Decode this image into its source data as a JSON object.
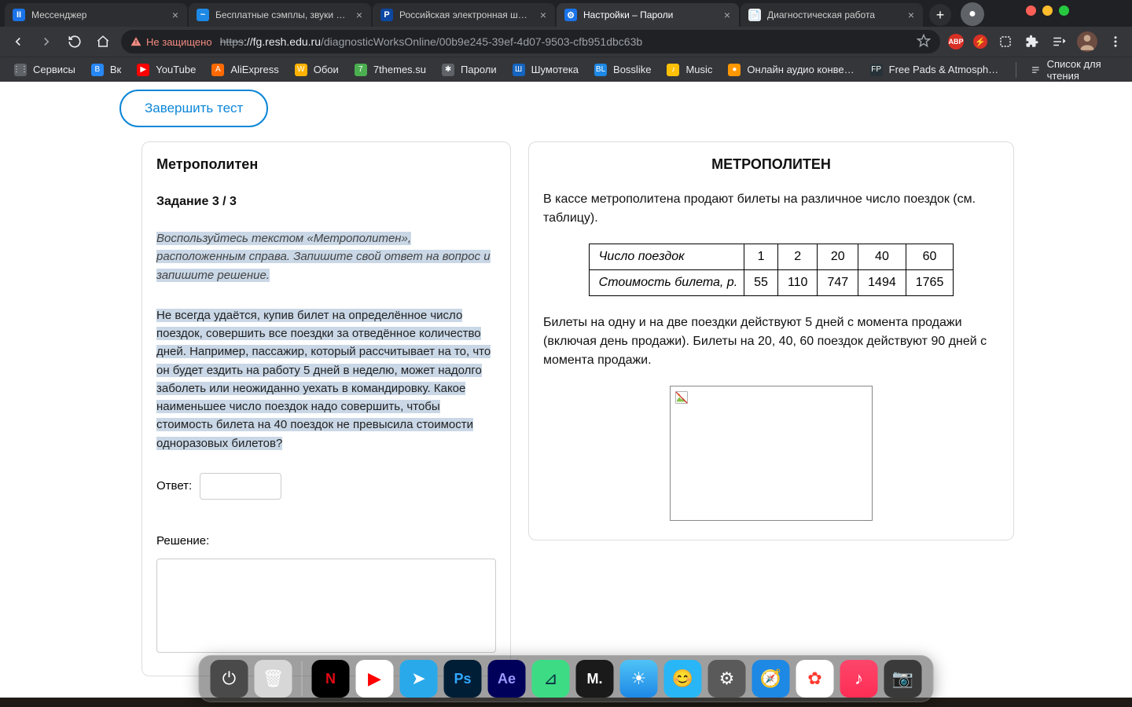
{
  "traffic_lights": [
    "red",
    "yellow",
    "green"
  ],
  "tabs": [
    {
      "favicon_bg": "#1a73e8",
      "favicon_txt": "II",
      "title": "Мессенджер",
      "active": false
    },
    {
      "favicon_bg": "#1e88e5",
      "favicon_txt": "~",
      "title": "Бесплатные сэмплы, звуки и лупы",
      "active": false
    },
    {
      "favicon_bg": "#0d47a1",
      "favicon_txt": "Р",
      "title": "Российская электронная школа",
      "active": false
    },
    {
      "favicon_bg": "#1a73e8",
      "favicon_txt": "⚙",
      "title": "Настройки – Пароли",
      "active": true
    },
    {
      "favicon_bg": "#eceff1",
      "favicon_txt": "📄",
      "title": "Диагностическая работа",
      "active": false
    }
  ],
  "toolbar": {
    "not_secure": "Не защищено",
    "url_strike": "https",
    "url_host": "://fg.resh.edu.ru",
    "url_path": "/diagnosticWorksOnline/00b9e245-39ef-4d07-9503-cfb951dbc63b"
  },
  "ext": {
    "abp": "ABP"
  },
  "bookmarks": [
    {
      "icon_bg": "#5f6368",
      "icon_txt": "⋮⋮",
      "label": "Сервисы"
    },
    {
      "icon_bg": "#2787f5",
      "icon_txt": "В",
      "label": "Вк"
    },
    {
      "icon_bg": "#ff0000",
      "icon_txt": "▶",
      "label": "YouTube"
    },
    {
      "icon_bg": "#ff6a00",
      "icon_txt": "A",
      "label": "AliExpress"
    },
    {
      "icon_bg": "#ffb300",
      "icon_txt": "W",
      "label": "Обои"
    },
    {
      "icon_bg": "#4caf50",
      "icon_txt": "7",
      "label": "7themes.su"
    },
    {
      "icon_bg": "#5f6368",
      "icon_txt": "✱",
      "label": "Пароли"
    },
    {
      "icon_bg": "#1565c0",
      "icon_txt": "Ш",
      "label": "Шумотека"
    },
    {
      "icon_bg": "#1e88e5",
      "icon_txt": "BL",
      "label": "Bosslike"
    },
    {
      "icon_bg": "#ffc107",
      "icon_txt": "♪",
      "label": "Music"
    },
    {
      "icon_bg": "#ff9800",
      "icon_txt": "●",
      "label": "Онлайн аудио конве…"
    },
    {
      "icon_bg": "#263238",
      "icon_txt": "FP",
      "label": "Free Pads & Atmosph…"
    }
  ],
  "reading_list": "Список для чтения",
  "page": {
    "finish": "Завершить тест",
    "left": {
      "title": "Метрополитен",
      "task_no": "Задание 3 / 3",
      "instruction": "Воспользуйтесь текстом «Метрополитен», расположенным справа. Запишите свой ответ на вопрос и запишите решение.",
      "body_text": "Не всегда удаётся, купив билет на определённое число поездок, совершить все поездки за отведённое количество дней. Например, пассажир, который рассчитывает на то, что он будет ездить на работу 5 дней в неделю, может надолго заболеть или неожиданно уехать в командировку.\nКакое наименьшее число поездок надо совершить, чтобы стоимость билета на 40 поездок не превысила стоимости одноразовых билетов?",
      "answer_label": "Ответ:",
      "solution_label": "Решение:"
    },
    "right": {
      "heading": "МЕТРОПОЛИТЕН",
      "intro": "В кассе метрополитена продают билеты на различное число поездок (см. таблицу).",
      "table": {
        "row1_label": "Число поездок",
        "row2_label": "Стоимость билета, р.",
        "cols": [
          "1",
          "2",
          "20",
          "40",
          "60"
        ],
        "prices": [
          "55",
          "110",
          "747",
          "1494",
          "1765"
        ]
      },
      "note": "Билеты на одну и на две поездки действуют 5 дней с момента продажи (включая день продажи). Билеты на 20, 40, 60 поездок действуют 90 дней с момента продажи."
    }
  },
  "dock": [
    {
      "name": "power",
      "bg": "#4a4a4a",
      "glyph": "⏻"
    },
    {
      "name": "trash",
      "bg": "#d7d7d7",
      "glyph": "🗑"
    },
    {
      "name": "netflix",
      "bg": "#000",
      "glyph": "N",
      "color": "#e50914"
    },
    {
      "name": "youtube",
      "bg": "#fff",
      "glyph": "▶",
      "color": "#ff0000"
    },
    {
      "name": "telegram",
      "bg": "#29a9ea",
      "glyph": "➤"
    },
    {
      "name": "photoshop",
      "bg": "#001e36",
      "glyph": "Ps",
      "color": "#31a8ff"
    },
    {
      "name": "aftereffects",
      "bg": "#00005b",
      "glyph": "Ae",
      "color": "#9999ff"
    },
    {
      "name": "androidstudio",
      "bg": "#3ddc84",
      "glyph": "⊿",
      "color": "#073042"
    },
    {
      "name": "matlab",
      "bg": "#1a1a1a",
      "glyph": "M."
    },
    {
      "name": "weather",
      "bg": "linear-gradient(#4fc3f7,#1e88e5)",
      "glyph": "☀"
    },
    {
      "name": "finder",
      "bg": "#29b6f6",
      "glyph": "😊"
    },
    {
      "name": "settings",
      "bg": "#5a5a5a",
      "glyph": "⚙"
    },
    {
      "name": "safari",
      "bg": "#1e88e5",
      "glyph": "🧭"
    },
    {
      "name": "photos",
      "bg": "#fff",
      "glyph": "✿",
      "color": "#ff3b30"
    },
    {
      "name": "music",
      "bg": "linear-gradient(#fc466b,#ff2d55)",
      "glyph": "♪"
    },
    {
      "name": "camera",
      "bg": "#3a3a3a",
      "glyph": "📷"
    }
  ]
}
